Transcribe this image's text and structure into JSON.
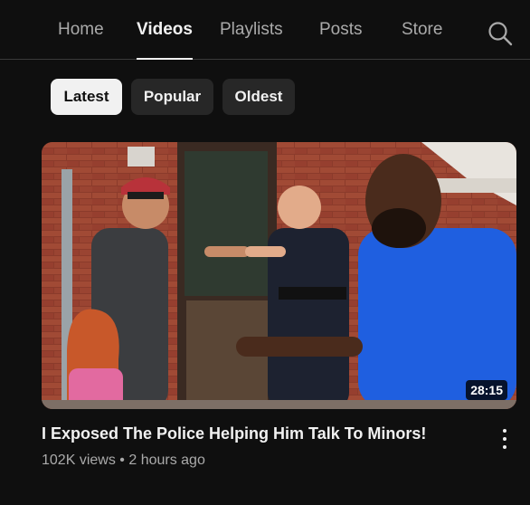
{
  "tabs": [
    {
      "label": "Home",
      "active": false
    },
    {
      "label": "Videos",
      "active": true
    },
    {
      "label": "Playlists",
      "active": false
    },
    {
      "label": "Posts",
      "active": false
    },
    {
      "label": "Store",
      "active": false
    }
  ],
  "search_icon": "search-icon",
  "chips": [
    {
      "label": "Latest",
      "active": true
    },
    {
      "label": "Popular",
      "active": false
    },
    {
      "label": "Oldest",
      "active": false
    }
  ],
  "video": {
    "duration": "28:15",
    "title": "I Exposed The Police Helping Him Talk To Minors!",
    "views": "102K views",
    "separator": "•",
    "age": "2 hours ago"
  },
  "menu_icon": "more-vert-icon"
}
